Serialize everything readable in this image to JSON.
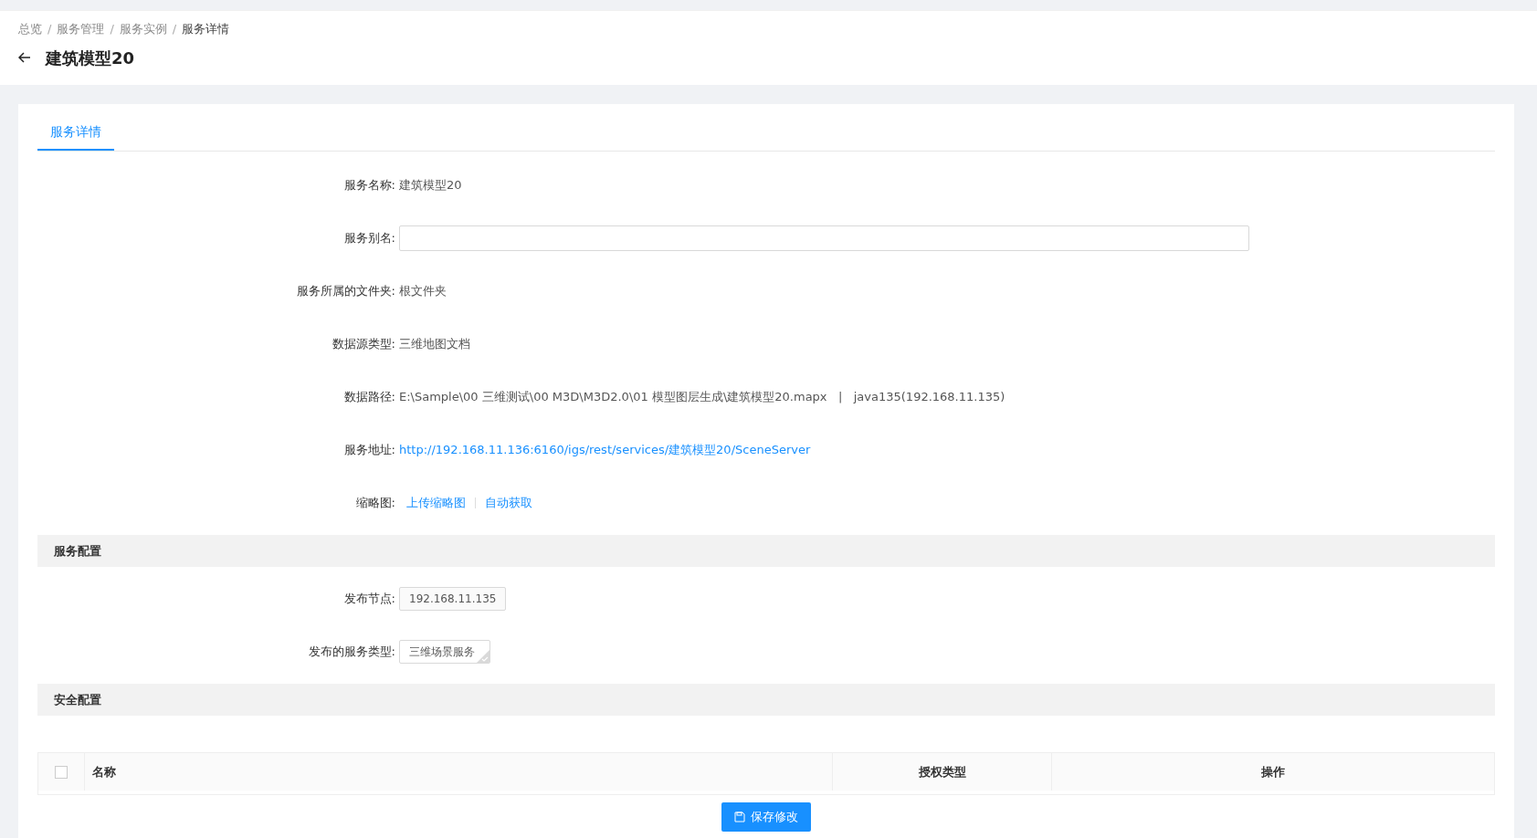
{
  "breadcrumb_separator": "/",
  "breadcrumb": [
    {
      "label": "总览",
      "current": false
    },
    {
      "label": "服务管理",
      "current": false
    },
    {
      "label": "服务实例",
      "current": false
    },
    {
      "label": "服务详情",
      "current": true
    }
  ],
  "title": "建筑模型20",
  "tabs": [
    {
      "label": "服务详情",
      "selected": true
    }
  ],
  "details": [
    {
      "kind": "text",
      "label": "服务名称:",
      "value": "建筑模型20"
    },
    {
      "kind": "input",
      "label": "服务别名:"
    },
    {
      "kind": "text",
      "label": "服务所属的文件夹:",
      "value": "根文件夹"
    },
    {
      "kind": "text",
      "label": "数据源类型:",
      "value": "三维地图文档"
    },
    {
      "kind": "text",
      "label": "数据路径:",
      "value": "E:\\Sample\\00 三维测试\\00 M3D\\M3D2.0\\01 模型图层生成\\建筑模型20.mapx   |   java135(192.168.11.135)"
    },
    {
      "kind": "link",
      "label": "服务地址:",
      "value": "http://192.168.11.136:6160/igs/rest/services/建筑模型20/SceneServer"
    },
    {
      "kind": "links",
      "label": "缩略图:",
      "links": [
        "上传缩略图",
        "自动获取"
      ]
    }
  ],
  "service_config": {
    "title": "服务配置",
    "fields": [
      {
        "label": "发布节点:",
        "value": "192.168.11.135",
        "checked": false
      },
      {
        "label": "发布的服务类型:",
        "value": "三维场景服务",
        "checked": true
      }
    ]
  },
  "security_config": {
    "title": "安全配置",
    "table": {
      "select_all_checked": false,
      "columns": [
        "名称",
        "授权类型",
        "操作"
      ]
    }
  },
  "save_button": "保存修改"
}
